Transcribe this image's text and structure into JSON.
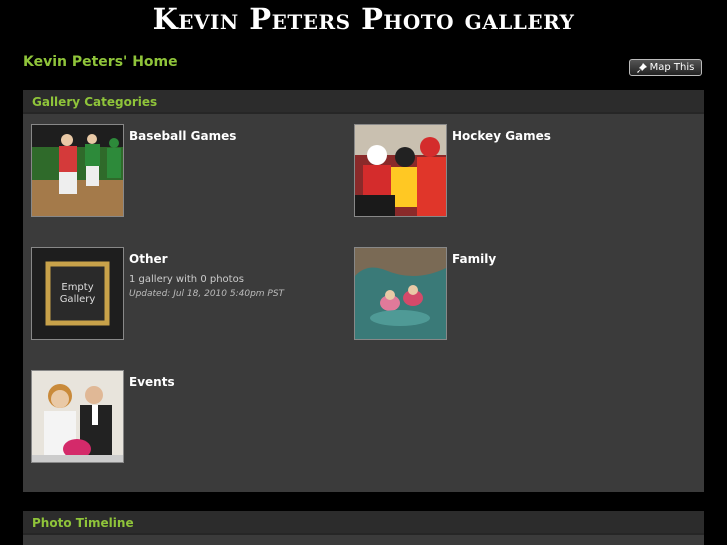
{
  "header": {
    "site_title": "Kevin Peters Photo gallery"
  },
  "nav": {
    "home_link": "Kevin Peters' Home",
    "map_button": "Map This",
    "map_icon": "pin-icon"
  },
  "categories_panel": {
    "title": "Gallery Categories",
    "items": [
      {
        "name": "Baseball Games",
        "subtitle": "",
        "updated": ""
      },
      {
        "name": "Hockey Games",
        "subtitle": "",
        "updated": ""
      },
      {
        "name": "Other",
        "subtitle": "1 gallery with 0 photos",
        "updated": "Updated: Jul 18, 2010 5:40pm PST",
        "thumb_text_line1": "Empty",
        "thumb_text_line2": "Gallery"
      },
      {
        "name": "Family",
        "subtitle": "",
        "updated": ""
      },
      {
        "name": "Events",
        "subtitle": "",
        "updated": ""
      }
    ]
  },
  "timeline_panel": {
    "title": "Photo Timeline"
  },
  "colors": {
    "accent": "#8fc43a",
    "panel_bg": "#3b3b3b",
    "page_bg": "#000000"
  }
}
